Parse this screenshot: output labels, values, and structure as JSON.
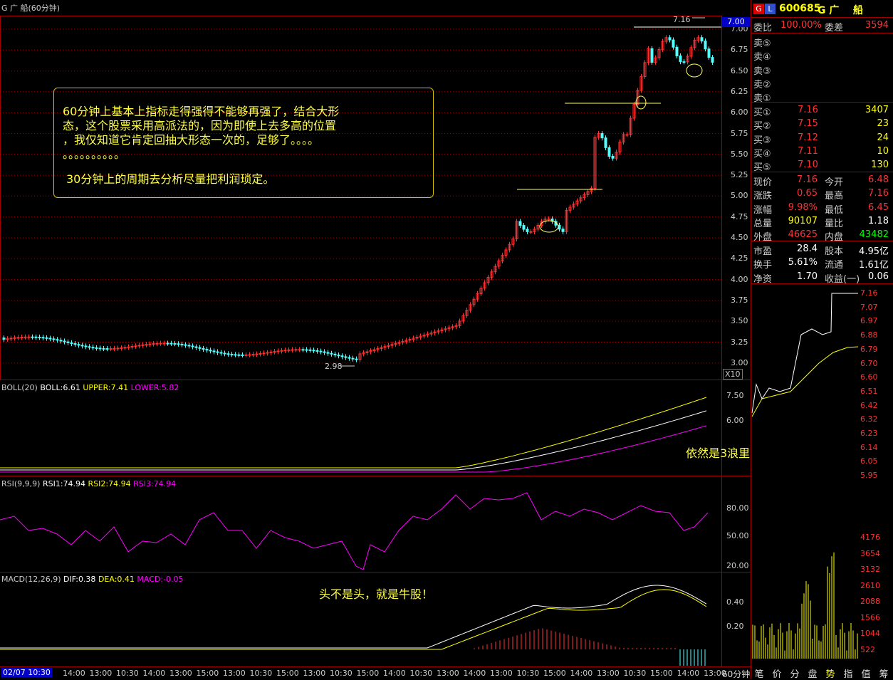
{
  "window": {
    "title": "G 广  船(60分钟)",
    "period_label": "60分钟",
    "axis_multiplier": "X10"
  },
  "main_chart": {
    "price_ticks": [
      "7.00",
      "6.75",
      "6.50",
      "6.25",
      "6.00",
      "5.75",
      "5.50",
      "5.25",
      "5.00",
      "4.75",
      "4.50",
      "4.25",
      "4.00",
      "3.75",
      "3.50",
      "3.25",
      "3.00"
    ],
    "current_price_tag": "7.00",
    "high_label": "7.16",
    "low_label": "2.98"
  },
  "boll": {
    "header": "BOLL(20)",
    "boll_value": "BOLL:6.61",
    "upper_value": "UPPER:7.41",
    "lower_value": "LOWER:5.82",
    "ticks": [
      "7.50",
      "6.00"
    ]
  },
  "rsi": {
    "header": "RSI(9,9,9)",
    "rsi1": "RSI1:74.94",
    "rsi2": "RSI2:74.94",
    "rsi3": "RSI3:74.94",
    "ticks": [
      "80.00",
      "50.00",
      "20.00"
    ]
  },
  "macd": {
    "header": "MACD(12,26,9)",
    "dif": "DIF:0.38",
    "dea": "DEA:0.41",
    "macd": "MACD:-0.05",
    "ticks": [
      "0.40",
      "0.20"
    ]
  },
  "time_axis": {
    "cursor_label": "02/07 10:30",
    "labels": [
      "14:00",
      "13:00",
      "10:30",
      "14:00",
      "13:00",
      "15:00",
      "13:00",
      "10:30",
      "15:00",
      "13:00",
      "10:30",
      "15:00",
      "14:00",
      "10:30",
      "13:00",
      "14:00",
      "13:00",
      "10:30",
      "15:00",
      "14:00",
      "13:00",
      "10:30",
      "15:00",
      "14:00",
      "13:00"
    ]
  },
  "annotations": {
    "box_lines": [
      "60分钟上基本上指标走得强得不能够再强了，结合大形",
      "态，这个股票采用高派法的，因为即使上去多高的位置",
      "，我仅知道它肯定回抽大形态一次的，足够了。。。。",
      "。。。。。。。。。。",
      "30分钟上的周期去分析尽量把利润琐定。"
    ],
    "boll_note": "依然是3浪里",
    "macd_note": "头不是头，就是牛股！"
  },
  "quote_panel": {
    "code": "600685",
    "name": "G 广    船",
    "weibi_label": "委比",
    "weibi_value": "100.00%",
    "weicha_label": "委差",
    "weicha_value": "3594",
    "sells": [
      {
        "label": "卖⑤",
        "price": "",
        "vol": ""
      },
      {
        "label": "卖④",
        "price": "",
        "vol": ""
      },
      {
        "label": "卖③",
        "price": "",
        "vol": ""
      },
      {
        "label": "卖②",
        "price": "",
        "vol": ""
      },
      {
        "label": "卖①",
        "price": "",
        "vol": ""
      }
    ],
    "buys": [
      {
        "label": "买①",
        "price": "7.16",
        "vol": "3407"
      },
      {
        "label": "买②",
        "price": "7.15",
        "vol": "23"
      },
      {
        "label": "买③",
        "price": "7.12",
        "vol": "24"
      },
      {
        "label": "买④",
        "price": "7.11",
        "vol": "10"
      },
      {
        "label": "买⑤",
        "price": "7.10",
        "vol": "130"
      }
    ],
    "stats": [
      {
        "l1": "现价",
        "v1": "7.16",
        "l2": "今开",
        "v2": "6.48"
      },
      {
        "l1": "涨跌",
        "v1": "0.65",
        "l2": "最高",
        "v2": "7.16"
      },
      {
        "l1": "涨幅",
        "v1": "9.98%",
        "l2": "最低",
        "v2": "6.45"
      },
      {
        "l1": "总量",
        "v1": "90107",
        "l2": "量比",
        "v2": "1.18"
      },
      {
        "l1": "外盘",
        "v1": "46625",
        "l2": "内盘",
        "v2": "43482"
      }
    ],
    "fund": [
      {
        "l1": "市盈",
        "v1": "28.4",
        "l2": "股本",
        "v2": "4.95亿"
      },
      {
        "l1": "换手",
        "v1": "5.61%",
        "l2": "流通",
        "v2": "1.61亿"
      },
      {
        "l1": "净资",
        "v1": "1.70",
        "l2": "收益(一)",
        "v2": "0.06"
      }
    ]
  },
  "mini_chart": {
    "price_ticks": [
      "7.16",
      "7.07",
      "6.97",
      "6.88",
      "6.79",
      "6.70",
      "6.60",
      "6.51",
      "6.42",
      "6.32",
      "6.23",
      "6.14",
      "6.05",
      "5.95"
    ],
    "vol_ticks": [
      "4176",
      "3654",
      "3132",
      "2610",
      "2088",
      "1566",
      "1044",
      "522"
    ]
  },
  "bottom_tabs": [
    "笔",
    "价",
    "分",
    "盘",
    "势",
    "指",
    "值",
    "筹"
  ],
  "active_tab": "势",
  "colors": {
    "up": "#ff3232",
    "down": "#54ffff",
    "grid": "#a00000",
    "yellow": "#ffff00",
    "magenta": "#ff00ff",
    "white": "#ffffff"
  }
}
